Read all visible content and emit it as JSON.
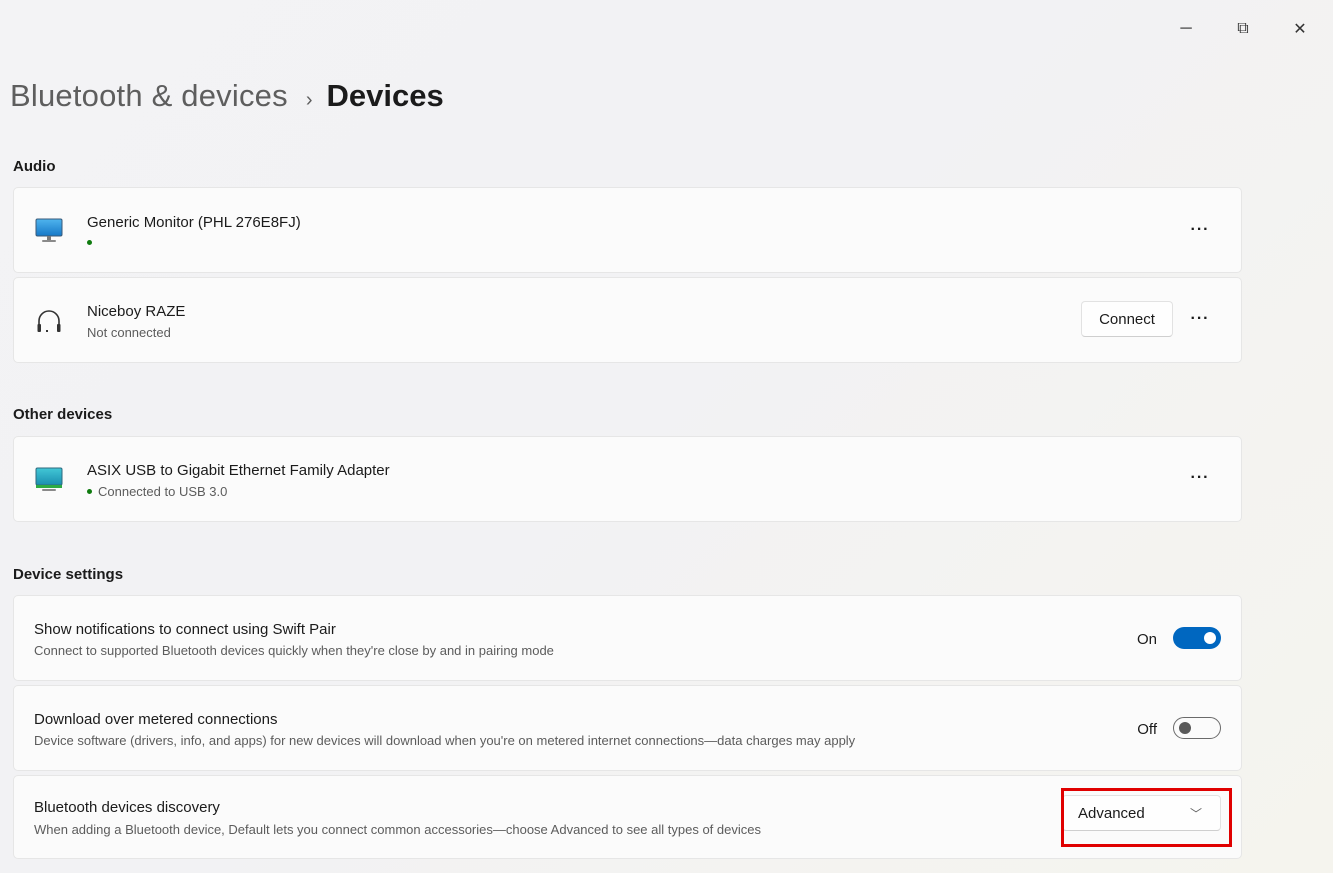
{
  "window": {
    "minimize_glyph": "─",
    "maximize_glyph": "⧉",
    "close_glyph": "✕"
  },
  "breadcrumb": {
    "parent": "Bluetooth & devices",
    "separator": "›",
    "current": "Devices"
  },
  "sections": {
    "audio": "Audio",
    "other": "Other devices",
    "settings": "Device settings"
  },
  "audio_devices": [
    {
      "name": "Generic Monitor (PHL 276E8FJ)",
      "status": "",
      "connected": true,
      "icon": "monitor-icon"
    },
    {
      "name": "Niceboy RAZE",
      "status": "Not connected",
      "connected": false,
      "icon": "headphones-icon",
      "connect_label": "Connect"
    }
  ],
  "other_devices": [
    {
      "name": "ASIX USB to Gigabit Ethernet Family Adapter",
      "status": "Connected to USB 3.0",
      "connected": true,
      "icon": "monitor-icon"
    }
  ],
  "more_label": "···",
  "settings": {
    "swift_pair": {
      "title": "Show notifications to connect using Swift Pair",
      "desc": "Connect to supported Bluetooth devices quickly when they're close by and in pairing mode",
      "state_label": "On",
      "on": true
    },
    "metered": {
      "title": "Download over metered connections",
      "desc": "Device software (drivers, info, and apps) for new devices will download when you're on metered internet connections—data charges may apply",
      "state_label": "Off",
      "on": false
    },
    "discovery": {
      "title": "Bluetooth devices discovery",
      "desc": "When adding a Bluetooth device, Default lets you connect common accessories—choose Advanced to see all types of devices",
      "selected": "Advanced",
      "chevron": "﹀"
    }
  },
  "colors": {
    "accent": "#0067c0",
    "status_green": "#0f7b0f",
    "highlight": "#e00000"
  }
}
